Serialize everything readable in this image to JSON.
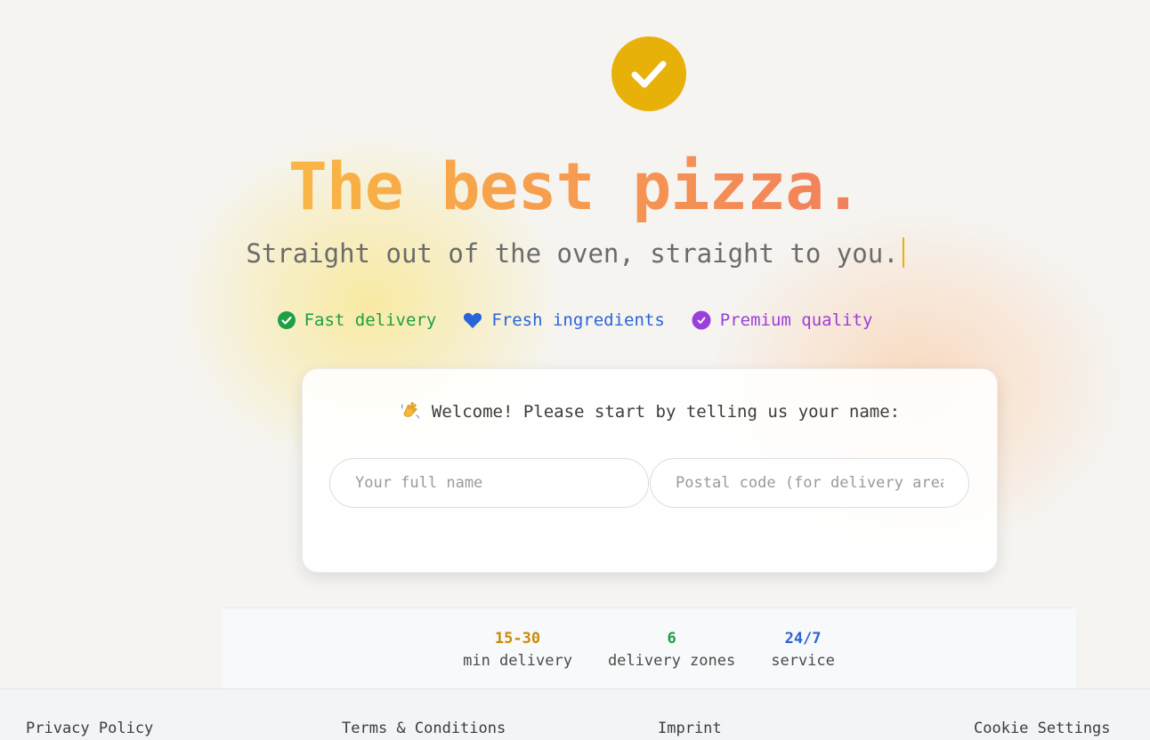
{
  "hero": {
    "title": "The best pizza.",
    "subtitle": "Straight out of the oven, straight to you."
  },
  "features": [
    {
      "label": "Fast delivery",
      "color": "#1e9e45",
      "icon": "check-circle-icon"
    },
    {
      "label": "Fresh ingredients",
      "color": "#2a64d9",
      "icon": "heart-icon"
    },
    {
      "label": "Premium quality",
      "color": "#9b3fd9",
      "icon": "badge-check-icon"
    }
  ],
  "form": {
    "welcome": "Welcome! Please start by telling us your name:",
    "welcome_icon": "waving-hand-icon",
    "name_placeholder": "Your full name",
    "postal_placeholder": "Postal code (for delivery area)"
  },
  "stats": [
    {
      "value": "15-30",
      "label": "min delivery",
      "color": "#c98b0a"
    },
    {
      "value": "6",
      "label": "delivery zones",
      "color": "#1e9e45"
    },
    {
      "value": "24/7",
      "label": "service",
      "color": "#2a64d9"
    }
  ],
  "footer": {
    "privacy": "Privacy Policy",
    "terms": "Terms & Conditions",
    "imprint": "Imprint",
    "cookies": "Cookie Settings"
  },
  "colors": {
    "brand": "#e7b10a",
    "background": "#f5f4f1"
  }
}
